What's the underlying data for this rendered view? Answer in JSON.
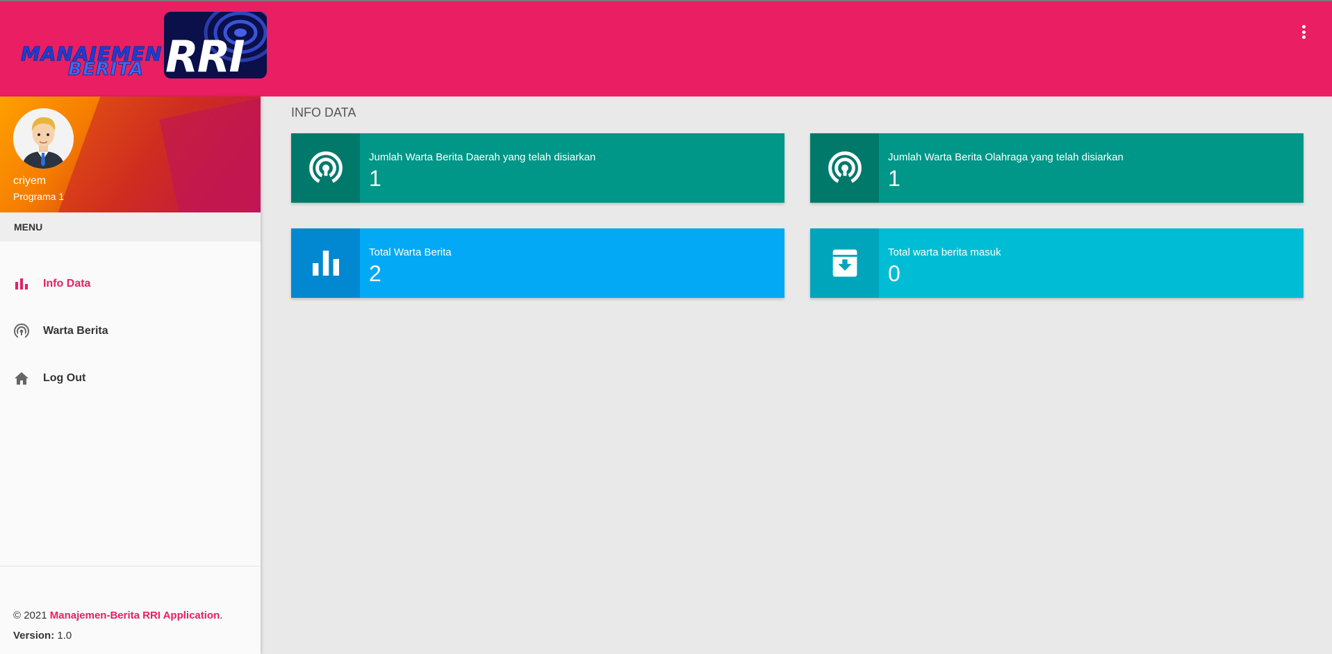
{
  "header": {
    "logo_line1": "MANAJEMEN",
    "logo_line2": "BERITA",
    "logo_badge": "RRI"
  },
  "user": {
    "name": "criyem",
    "role": "Programa 1"
  },
  "menu": {
    "header": "MENU",
    "items": [
      {
        "label": "Info Data",
        "icon": "bar-chart-icon",
        "active": true
      },
      {
        "label": "Warta Berita",
        "icon": "broadcast-icon",
        "active": false
      },
      {
        "label": "Log Out",
        "icon": "home-icon",
        "active": false
      }
    ]
  },
  "footer": {
    "copyright": "© 2021",
    "app_name": "Manajemen-Berita RRI Application",
    "period": ".",
    "version_label": "Version:",
    "version_value": "1.0"
  },
  "main": {
    "title": "INFO DATA",
    "cards": [
      {
        "text": "Jumlah Warta Berita Daerah yang telah disiarkan",
        "number": "1",
        "icon": "broadcast-icon",
        "color": "#009688"
      },
      {
        "text": "Jumlah Warta Berita Olahraga yang telah disiarkan",
        "number": "1",
        "icon": "broadcast-icon",
        "color": "#009688"
      },
      {
        "text": "Total Warta Berita",
        "number": "2",
        "icon": "bar-chart-icon",
        "color": "#03a9f4"
      },
      {
        "text": "Total warta berita masuk",
        "number": "0",
        "icon": "archive-icon",
        "color": "#00bcd4"
      }
    ]
  },
  "colors": {
    "primary": "#e91e63",
    "teal": "#009688",
    "light_blue": "#03a9f4",
    "cyan": "#00bcd4"
  }
}
